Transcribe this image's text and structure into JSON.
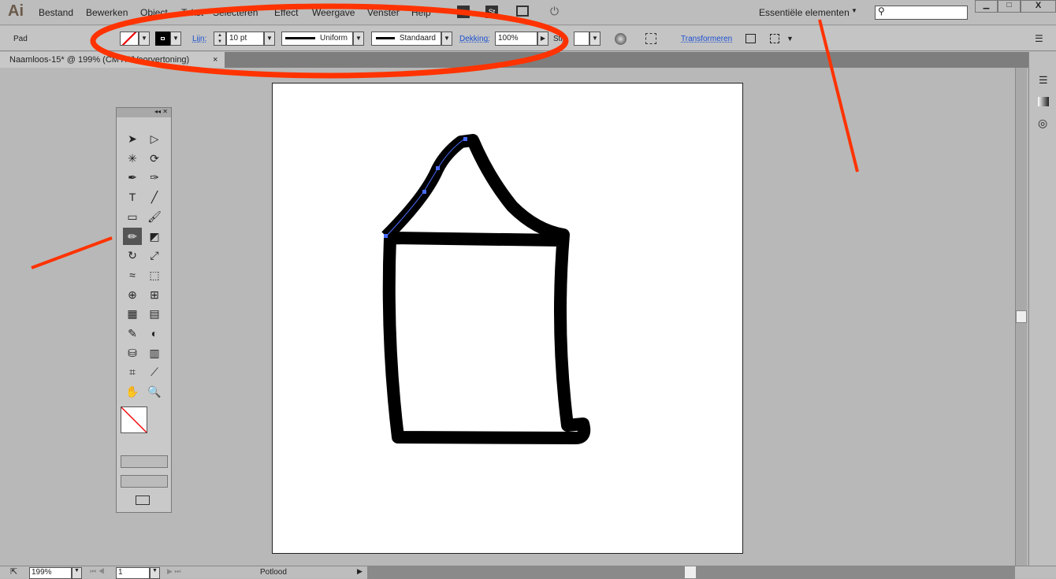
{
  "app": {
    "logo": "Ai"
  },
  "menu": [
    "Bestand",
    "Bewerken",
    "Object",
    "Tekst",
    "Selecteren",
    "Effect",
    "Weergave",
    "Venster",
    "Help"
  ],
  "workspace": "Essentiële elementen",
  "search": {
    "value": "",
    "placeholder": ""
  },
  "control": {
    "type": "Pad",
    "stroke_label": "Lijn:",
    "stroke_weight": "10 pt",
    "profile": "Uniform",
    "brush": "Standaard",
    "opacity_label": "Dekking:",
    "opacity": "100%",
    "style_label": "Stijl:",
    "transform": "Transformeren"
  },
  "document_tab": {
    "title": "Naamloos-15* @ 199% (CMYK/Voorvertoning)",
    "close": "×"
  },
  "status": {
    "zoom": "199%",
    "page": "1",
    "tool": "Potlood"
  },
  "colors": {
    "annotation": "#ff3300",
    "accent_link": "#1a4fd0"
  },
  "tools": [
    "selection",
    "direct-selection",
    "magic-wand",
    "lasso",
    "pen",
    "curvature",
    "type",
    "line",
    "rectangle",
    "paintbrush",
    "pencil",
    "eraser",
    "rotate",
    "scale",
    "warp",
    "free-transform",
    "shape-builder",
    "perspective",
    "mesh",
    "gradient",
    "eyedropper",
    "blend",
    "symbol-sprayer",
    "graph",
    "artboard",
    "slice",
    "hand",
    "zoom"
  ]
}
